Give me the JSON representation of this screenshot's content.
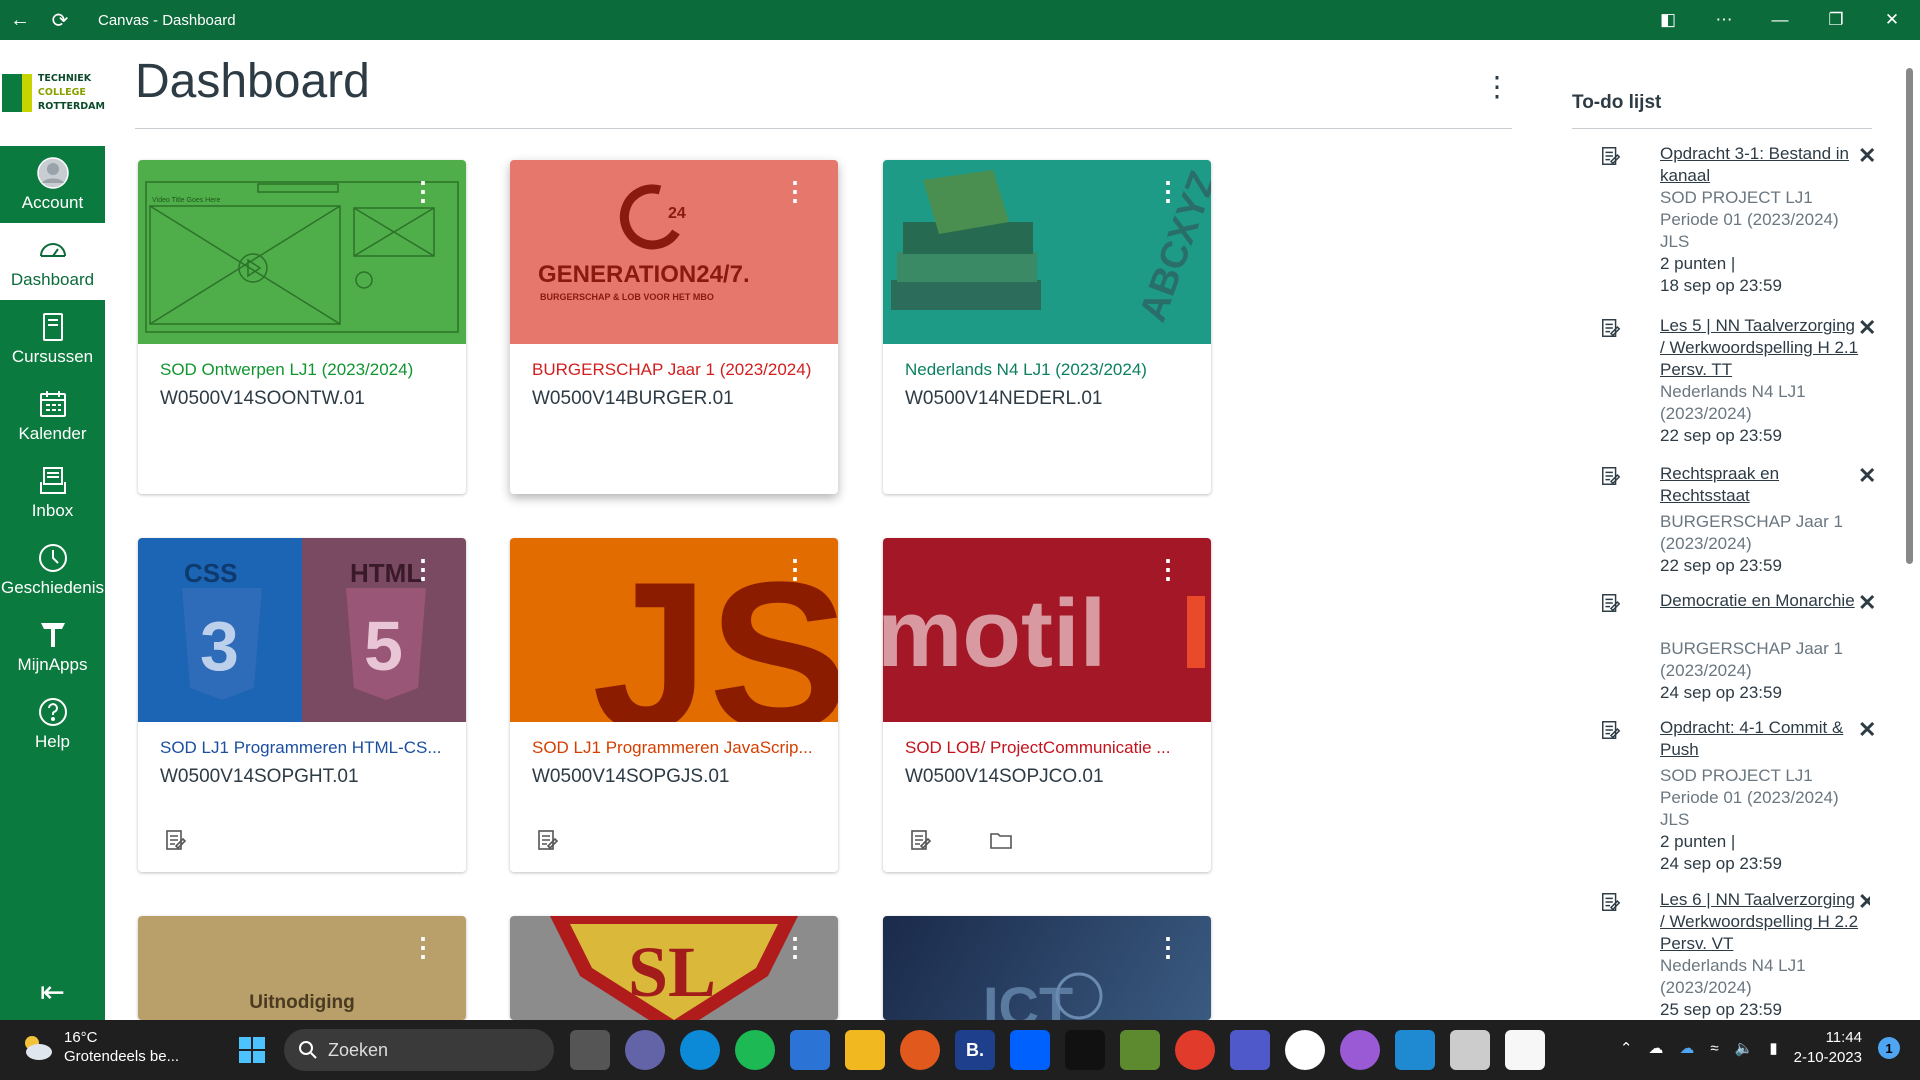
{
  "window": {
    "title": "Canvas - Dashboard"
  },
  "logo": {
    "line1": "TECHNIEK",
    "line2": "COLLEGE",
    "line3": "ROTTERDAM"
  },
  "nav": [
    {
      "label": "Account",
      "icon": "account-icon"
    },
    {
      "label": "Dashboard",
      "icon": "dashboard-icon",
      "active": true
    },
    {
      "label": "Cursussen",
      "icon": "courses-icon"
    },
    {
      "label": "Kalender",
      "icon": "calendar-icon"
    },
    {
      "label": "Inbox",
      "icon": "inbox-icon"
    },
    {
      "label": "Geschiedenis",
      "icon": "history-icon"
    },
    {
      "label": "MijnApps",
      "icon": "apps-icon"
    },
    {
      "label": "Help",
      "icon": "help-icon"
    }
  ],
  "page": {
    "title": "Dashboard"
  },
  "cards": [
    {
      "name": "SOD Ontwerpen LJ1 (2023/2024)",
      "code": "W0500V14SOONTW.01",
      "color": "#11962f",
      "hero_text": "Video Title Goes Here"
    },
    {
      "name": "BURGERSCHAP Jaar 1 (2023/2024)",
      "code": "W0500V14BURGER.01",
      "color": "#d21e1e",
      "hero_text": "GENERATION24/7.",
      "hero_sub": "BURGERSCHAP & LOB VOOR HET MBO",
      "hero_badge": "24"
    },
    {
      "name": "Nederlands N4 LJ1 (2023/2024)",
      "code": "W0500V14NEDERL.01",
      "color": "#0b7f5f",
      "hero_text": "ABCXYZ"
    },
    {
      "name": "SOD LJ1 Programmeren HTML-CS...",
      "code": "W0500V14SOPGHT.01",
      "color": "#1c4fa0",
      "hero_text": "CSS",
      "hero_text2": "HTML"
    },
    {
      "name": "SOD LJ1 Programmeren JavaScrip...",
      "code": "W0500V14SOPGJS.01",
      "color": "#d43f00",
      "hero_text": "JS"
    },
    {
      "name": "SOD LOB/ ProjectCommunicatie ...",
      "code": "W0500V14SOPJCO.01",
      "color": "#c4131c",
      "hero_text": "motil"
    },
    {
      "name": "",
      "code": "",
      "color": "#b9a06a",
      "hero_text": "Uitnodiging"
    },
    {
      "name": "",
      "code": "",
      "color": "#8c8c8c",
      "hero_text": "SL"
    },
    {
      "name": "",
      "code": "",
      "color": "#2b3a5c",
      "hero_text": "ICT"
    }
  ],
  "todo": {
    "title": "To-do lijst",
    "items": [
      {
        "link": "Opdracht 3-1: Bestand in kanaal",
        "course": "SOD PROJECT LJ1 Periode 01 (2023/2024) JLS",
        "points": "2 punten  |",
        "due": "18 sep op 23:59"
      },
      {
        "link": "Les 5 | NN Taalverzorging / Werkwoordspelling H 2.1 Persv. TT",
        "course": "Nederlands N4 LJ1 (2023/2024)",
        "points": "",
        "due": "22 sep op 23:59"
      },
      {
        "link": "Rechtspraak en Rechtsstaat",
        "course": "BURGERSCHAP Jaar 1 (2023/2024)",
        "points": "",
        "due": "22 sep op 23:59"
      },
      {
        "link": "Democratie en Monarchie",
        "course": "BURGERSCHAP Jaar 1 (2023/2024)",
        "points": "",
        "due": "24 sep op 23:59"
      },
      {
        "link": "Opdracht: 4-1 Commit & Push",
        "course": "SOD PROJECT LJ1 Periode 01 (2023/2024) JLS",
        "points": "2 punten  |",
        "due": "24 sep op 23:59"
      },
      {
        "link": "Les 6 | NN Taalverzorging / Werkwoordspelling H 2.2 Persv. VT",
        "course": "Nederlands N4 LJ1 (2023/2024)",
        "points": "",
        "due": "25 sep op 23:59"
      }
    ]
  },
  "taskbar": {
    "weather_temp": "16°C",
    "weather_desc": "Grotendeels be...",
    "search_placeholder": "Zoeken",
    "time": "11:44",
    "date": "2-10-2023",
    "notif_count": "1"
  }
}
